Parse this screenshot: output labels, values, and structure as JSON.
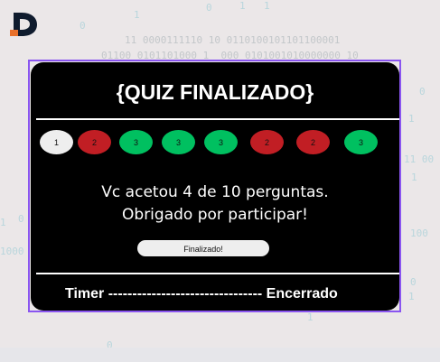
{
  "background": {
    "binary_fragments": [
      "11 0000111110 10 0110100101101100001",
      "01100 0101101000 1  000 0101001010000000 10",
      "1",
      "1",
      "1",
      "0",
      "0",
      "1",
      "1",
      "0",
      "1",
      "1",
      "0",
      "1",
      "11 00",
      "100",
      "1000",
      "0",
      "0"
    ]
  },
  "logo": {
    "letter": "D",
    "accent_color": "#e8702a",
    "color": "#0f1b2d"
  },
  "quiz": {
    "title": "{QUIZ FINALIZADO}",
    "answers": [
      {
        "label": "1",
        "status": "neutral"
      },
      {
        "label": "2",
        "status": "wrong"
      },
      {
        "label": "3",
        "status": "right"
      },
      {
        "label": "3",
        "status": "right"
      },
      {
        "label": "3",
        "status": "right"
      },
      {
        "label": "2",
        "status": "wrong"
      },
      {
        "label": "2",
        "status": "wrong"
      },
      {
        "label": "3",
        "status": "right"
      }
    ],
    "result_line1": "Vc acetou 4 de 10 perguntas.",
    "result_line2": "Obrigado por participar!",
    "finish_button": "Finalizado!",
    "footer": "Timer -------------------------------- Encerrado"
  },
  "colors": {
    "card": "#000000",
    "wrong": "#c11e24",
    "right": "#00c060",
    "neutral": "#eeeeee",
    "frame": "#8a55f0"
  }
}
